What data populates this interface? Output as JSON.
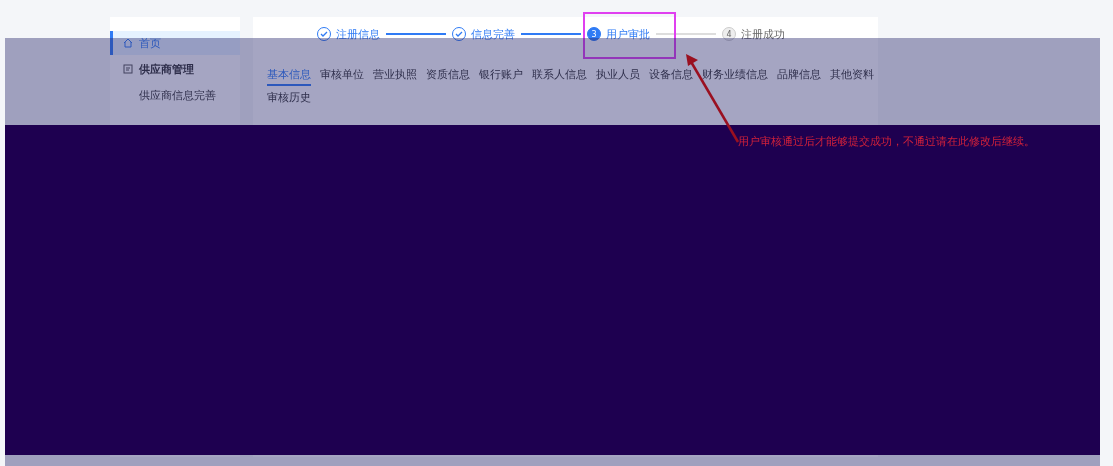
{
  "sidebar": {
    "items": [
      {
        "label": "首页",
        "kind": "home",
        "selected": true
      },
      {
        "label": "供应商管理",
        "kind": "group",
        "selected": false
      },
      {
        "label": "供应商信息完善",
        "kind": "sub",
        "selected": false
      }
    ]
  },
  "steps": [
    {
      "label": "注册信息",
      "kind": "done"
    },
    {
      "label": "信息完善",
      "kind": "done"
    },
    {
      "number": "3",
      "label": "用户审批",
      "kind": "active"
    },
    {
      "number": "4",
      "label": "注册成功",
      "kind": "pending"
    }
  ],
  "tabs": [
    {
      "label": "基本信息",
      "selected": true
    },
    {
      "label": "审核单位",
      "selected": false
    },
    {
      "label": "营业执照",
      "selected": false
    },
    {
      "label": "资质信息",
      "selected": false
    },
    {
      "label": "银行账户",
      "selected": false
    },
    {
      "label": "联系人信息",
      "selected": false
    },
    {
      "label": "执业人员",
      "selected": false
    },
    {
      "label": "设备信息",
      "selected": false
    },
    {
      "label": "财务业绩信息",
      "selected": false
    },
    {
      "label": "品牌信息",
      "selected": false
    },
    {
      "label": "其他资料",
      "selected": false
    },
    {
      "label": "审核历史",
      "selected": false
    }
  ],
  "annotation": {
    "text": "用户审核通过后才能够提交成功，不通过请在此修改后继续。"
  }
}
